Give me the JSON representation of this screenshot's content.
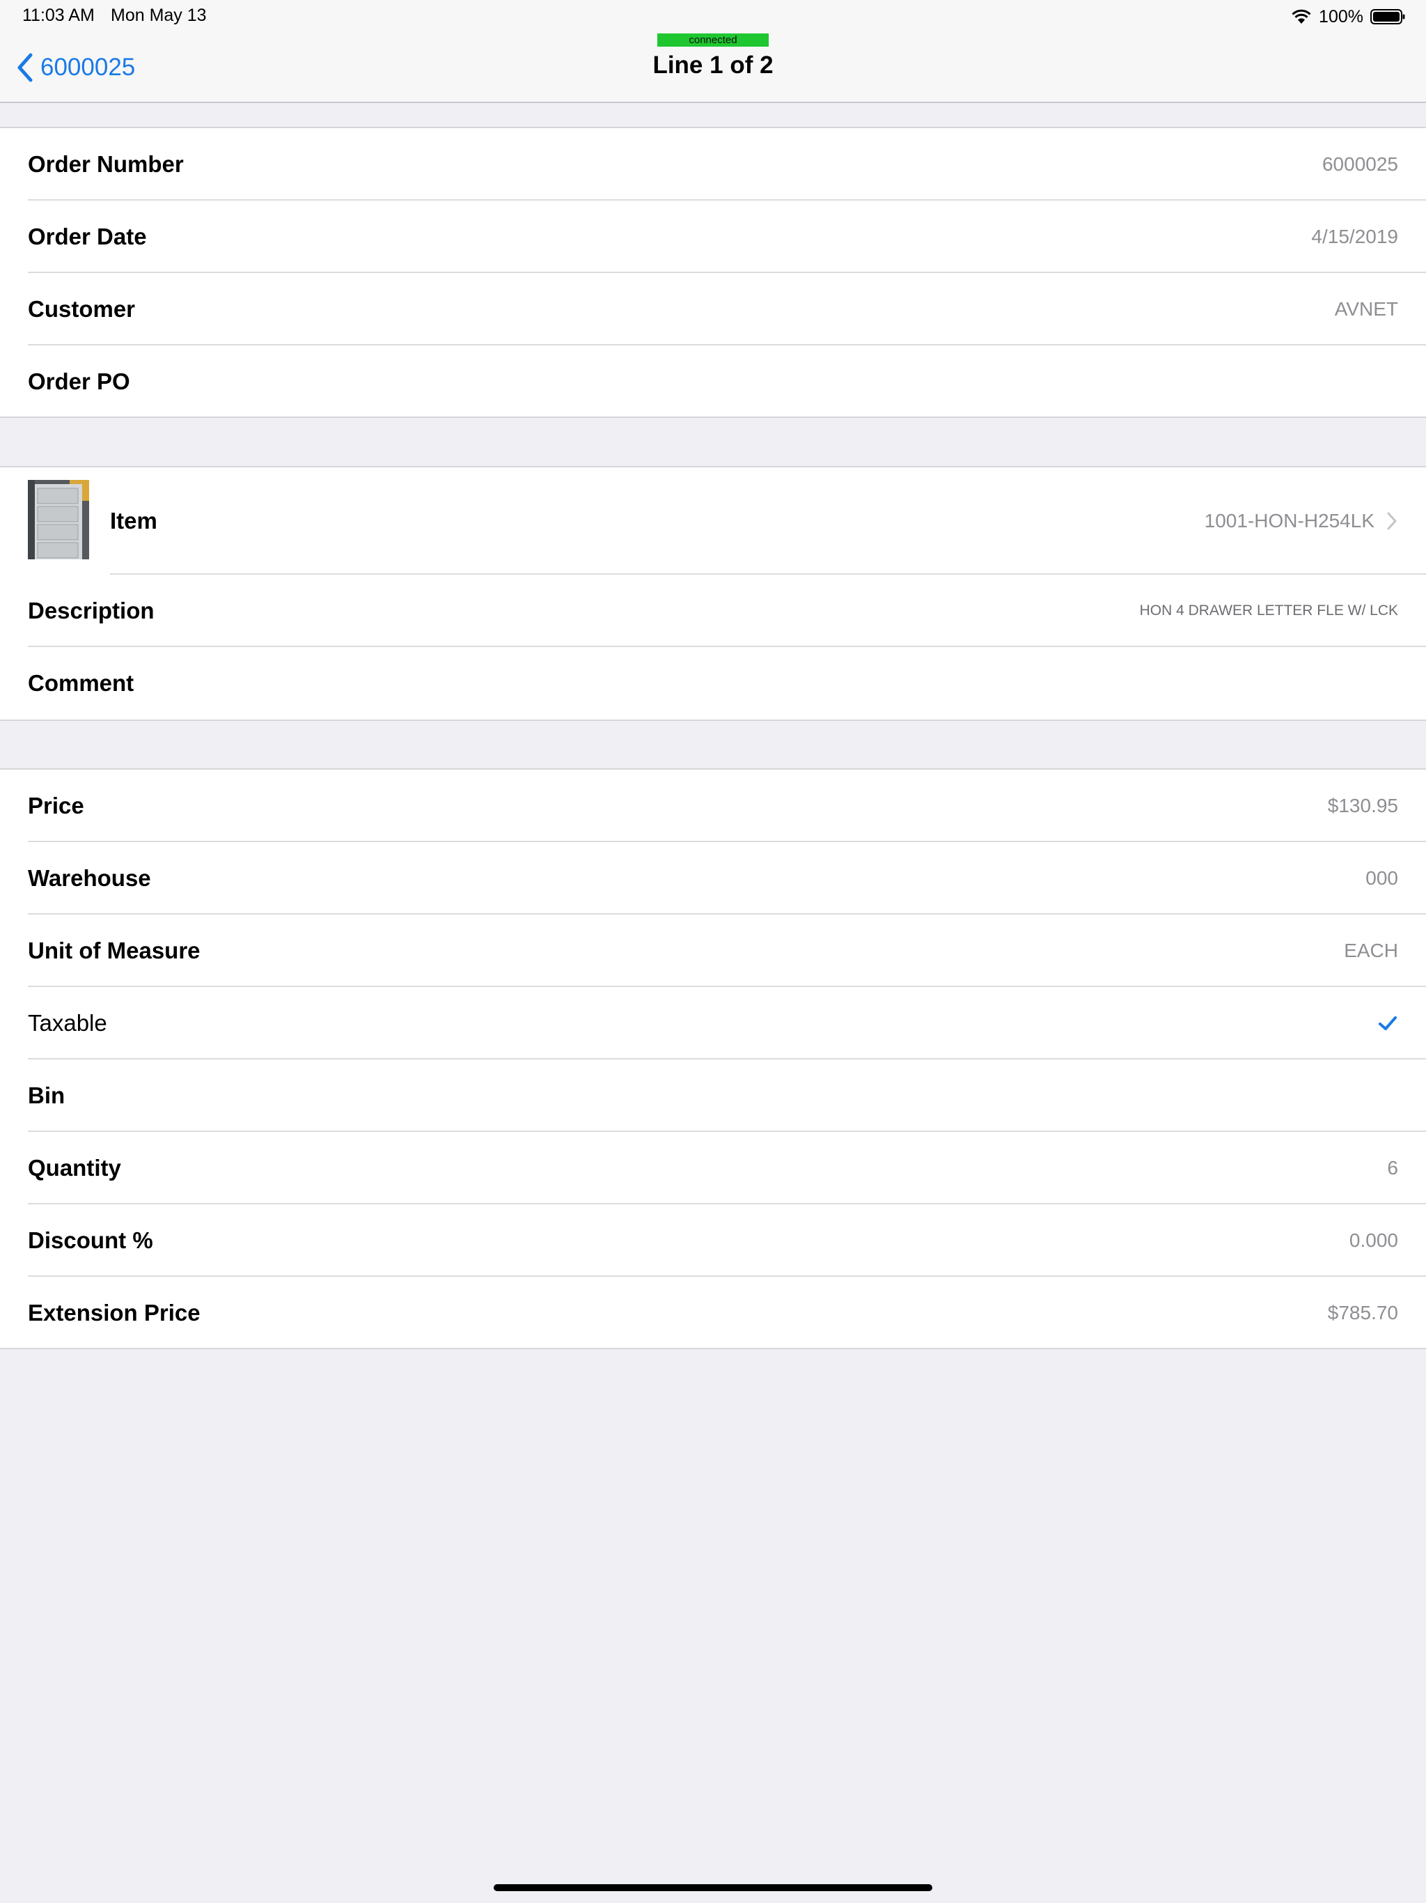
{
  "status_bar": {
    "time": "11:03 AM",
    "date": "Mon May 13",
    "battery": "100%"
  },
  "nav": {
    "back_label": "6000025",
    "connection_status": "connected",
    "title": "Line 1 of 2"
  },
  "order": {
    "rows": [
      {
        "label": "Order Number",
        "value": "6000025"
      },
      {
        "label": "Order Date",
        "value": "4/15/2019"
      },
      {
        "label": "Customer",
        "value": "AVNET"
      },
      {
        "label": "Order PO",
        "value": ""
      }
    ]
  },
  "item": {
    "label": "Item",
    "value": "1001-HON-H254LK",
    "description_label": "Description",
    "description_value": "HON 4 DRAWER LETTER FLE W/ LCK",
    "comment_label": "Comment",
    "comment_value": ""
  },
  "pricing": {
    "price_label": "Price",
    "price_value": "$130.95",
    "warehouse_label": "Warehouse",
    "warehouse_value": "000",
    "uom_label": "Unit of Measure",
    "uom_value": "EACH",
    "taxable_label": "Taxable",
    "taxable_checked": true,
    "bin_label": "Bin",
    "bin_value": "",
    "quantity_label": "Quantity",
    "quantity_value": "6",
    "discount_label": "Discount %",
    "discount_value": "0.000",
    "extension_label": "Extension Price",
    "extension_value": "$785.70"
  },
  "colors": {
    "accent": "#1a7ae6",
    "connected": "#1ec72f",
    "background": "#efeff4"
  }
}
